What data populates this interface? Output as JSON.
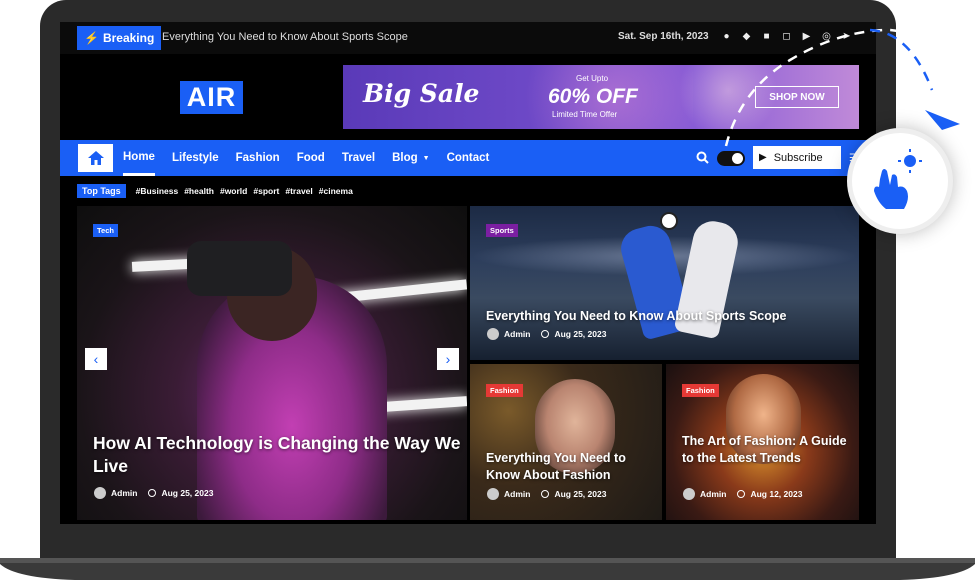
{
  "topbar": {
    "breaking_label": "Breaking",
    "ticker_text": "Everything You Need to Know About Sports Scope",
    "date": "Sat. Sep 16th, 2023",
    "socials": [
      "facebook-icon",
      "twitter-icon",
      "linkedin-icon",
      "instagram-icon",
      "youtube-icon",
      "saturn-icon",
      "telegram-icon"
    ]
  },
  "header": {
    "logo": "AIR",
    "banner": {
      "headline": "Big Sale",
      "upto": "Get Upto",
      "discount": "60% OFF",
      "subtext": "Limited Time Offer",
      "cta": "SHOP NOW"
    }
  },
  "nav": {
    "items": [
      "Home",
      "Lifestyle",
      "Fashion",
      "Food",
      "Travel",
      "Blog",
      "Contact"
    ],
    "active": "Home",
    "subscribe_label": "Subscribe"
  },
  "tags": {
    "label": "Top Tags",
    "items": [
      "#Business",
      "#health",
      "#world",
      "#sport",
      "#travel",
      "#cinema"
    ]
  },
  "posts": [
    {
      "category": "Tech",
      "title": "How AI Technology is Changing the Way We Live",
      "author": "Admin",
      "date": "Aug 25, 2023"
    },
    {
      "category": "Sports",
      "title": "Everything You Need to Know About Sports Scope",
      "author": "Admin",
      "date": "Aug 25, 2023"
    },
    {
      "category": "Fashion",
      "title": "Everything You Need to Know About Fashion",
      "author": "Admin",
      "date": "Aug 25, 2023"
    },
    {
      "category": "Fashion",
      "title": "The Art of Fashion: A Guide to the Latest Trends",
      "author": "Admin",
      "date": "Aug 12, 2023"
    }
  ],
  "colors": {
    "accent": "#1a5ff5",
    "tech_badge": "#1a5ff5",
    "sports_badge": "#7b1fa2",
    "fashion_badge": "#e53935",
    "laptop": "#2a2a2a"
  }
}
